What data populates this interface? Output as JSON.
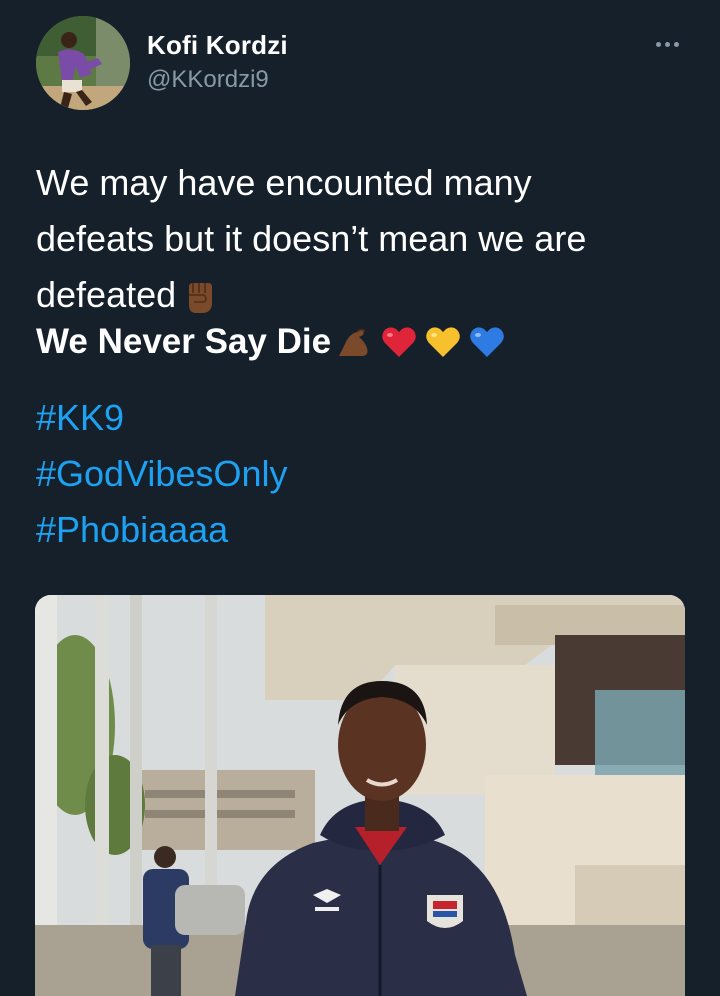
{
  "author": {
    "display_name": "Kofi Kordzi",
    "handle": "@KKordzi9",
    "avatar_icon": "profile-photo"
  },
  "menu": {
    "icon": "more-icon"
  },
  "tweet": {
    "text_lines": [
      "We may have encounted many",
      "defeats but it doesn’t mean we are",
      "defeated"
    ],
    "bold_line": "We Never Say Die",
    "emojis": [
      "raised-fist",
      "flexed-biceps",
      "red-heart",
      "yellow-heart",
      "blue-heart"
    ],
    "hashtags": [
      "#KK9",
      "#GodVibesOnly",
      "#Phobiaaaa"
    ]
  },
  "colors": {
    "background": "#15202b",
    "text": "#ffffff",
    "secondary": "#8899a6",
    "link": "#1da1f2"
  }
}
